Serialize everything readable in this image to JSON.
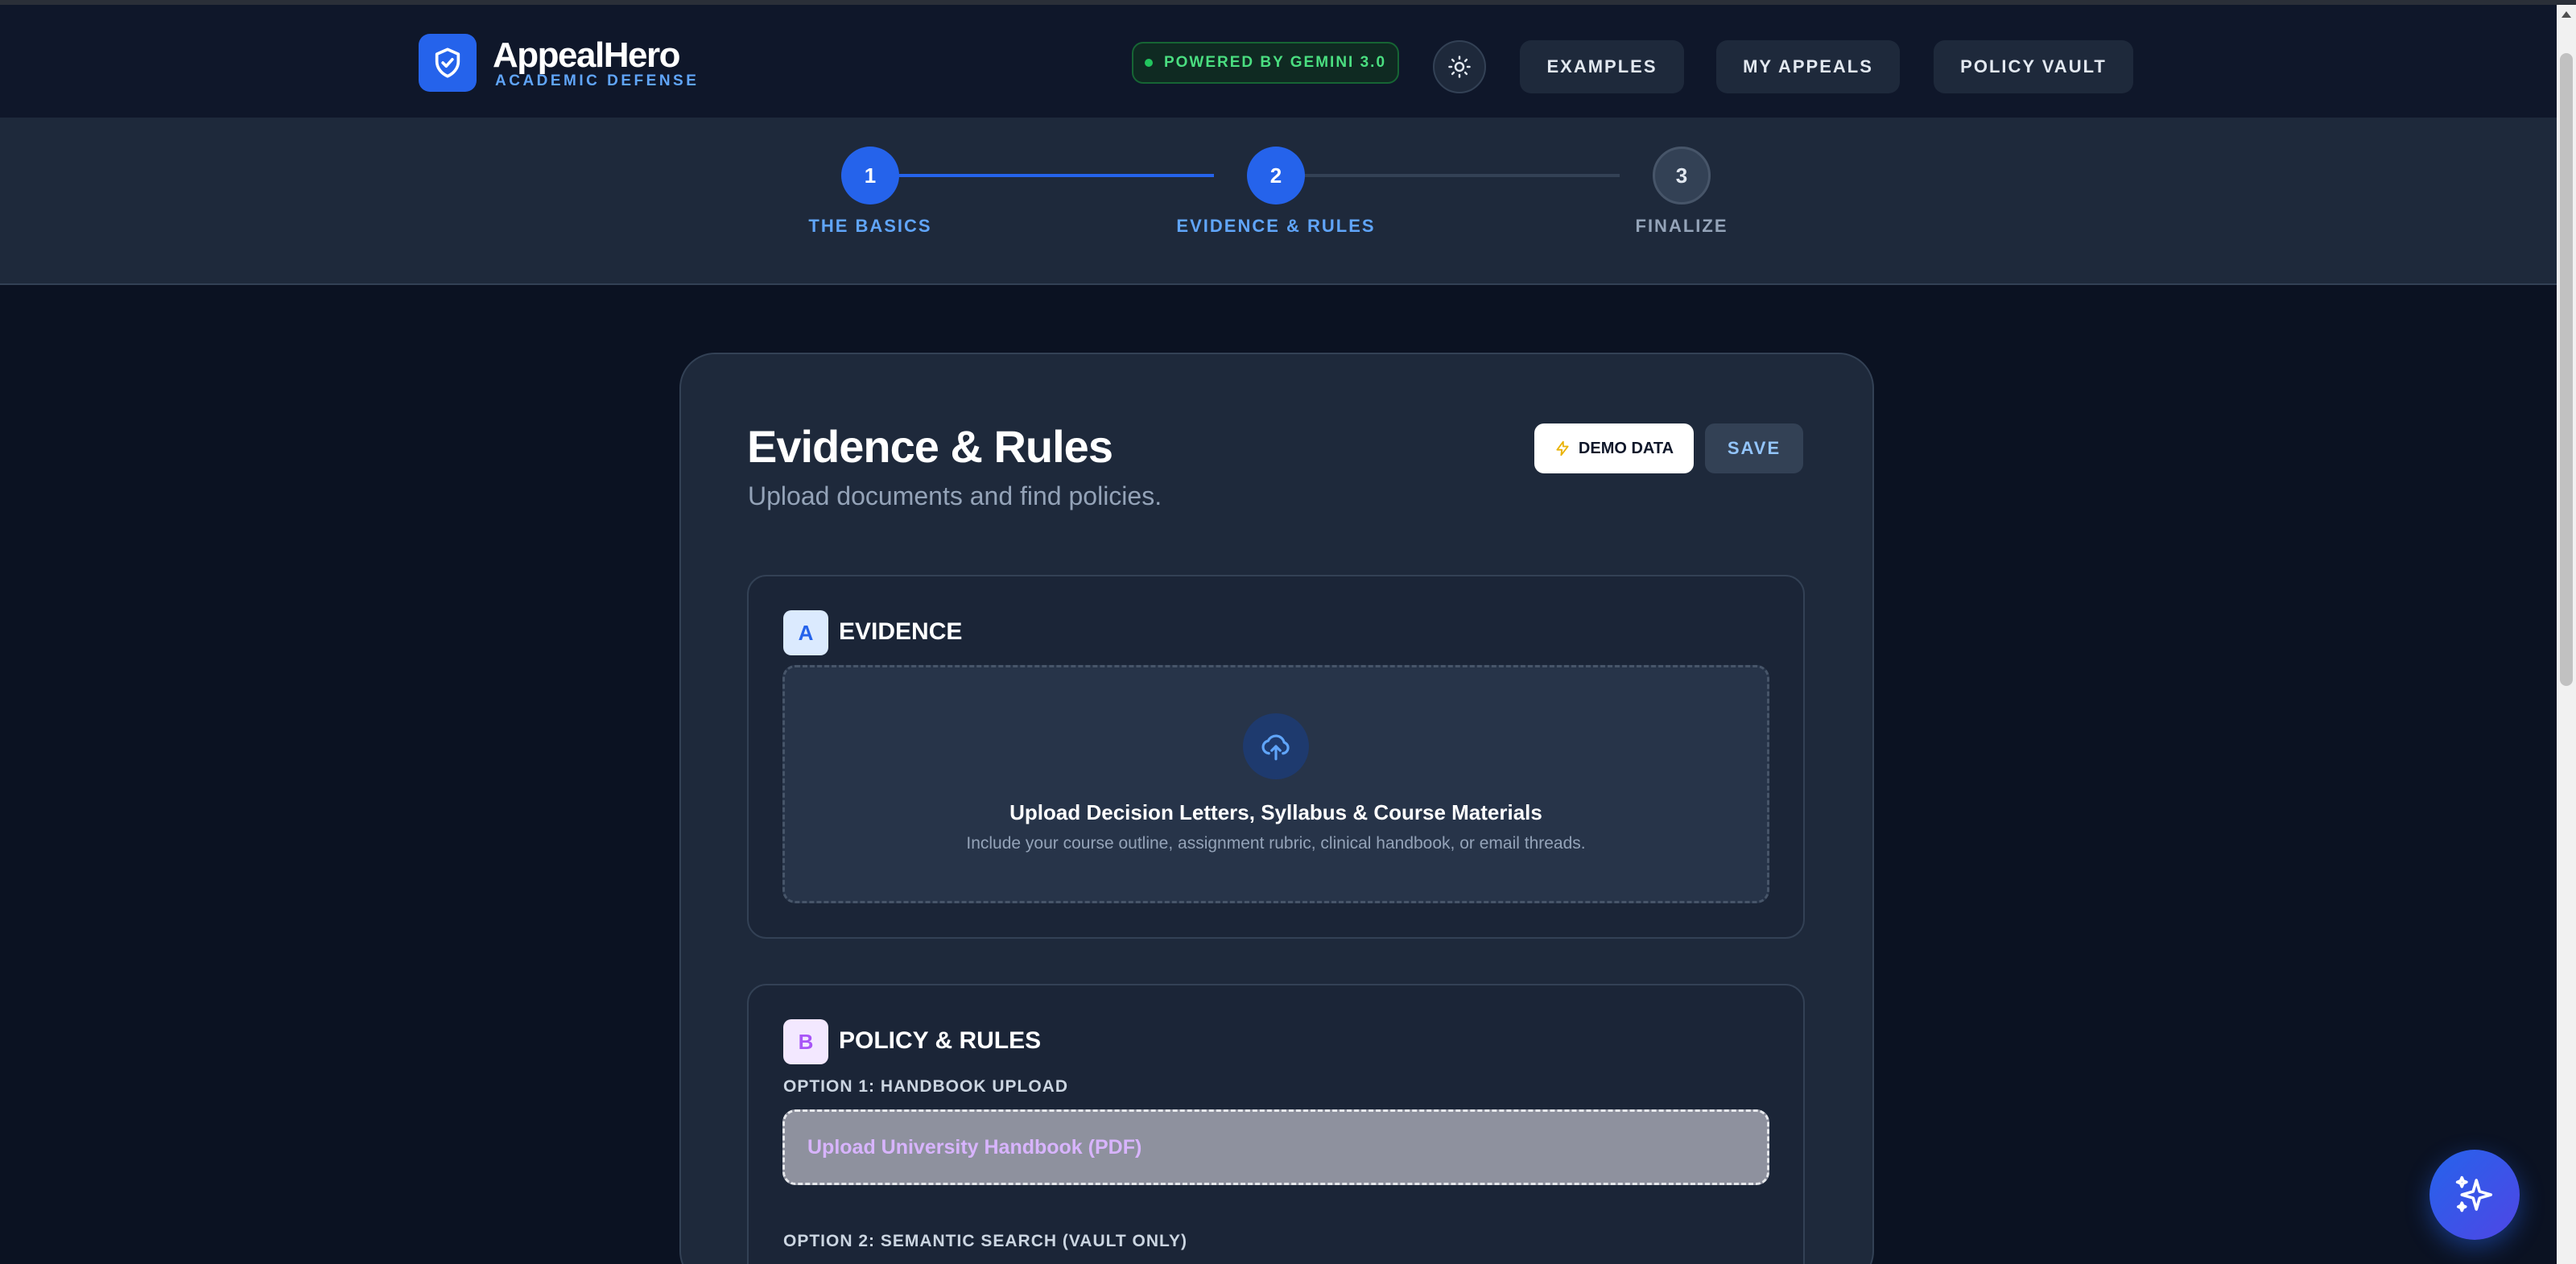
{
  "header": {
    "brand_name": "AppealHero",
    "brand_sub": "ACADEMIC DEFENSE",
    "powered_by": "POWERED BY GEMINI 3.0",
    "nav": {
      "examples": "EXAMPLES",
      "my_appeals": "MY APPEALS",
      "policy_vault": "POLICY VAULT"
    }
  },
  "stepper": {
    "steps": [
      {
        "number": "1",
        "label": "THE BASICS",
        "status": "complete"
      },
      {
        "number": "2",
        "label": "EVIDENCE & RULES",
        "status": "current"
      },
      {
        "number": "3",
        "label": "FINALIZE",
        "status": "upcoming"
      }
    ]
  },
  "main": {
    "title": "Evidence & Rules",
    "subtitle": "Upload documents and find policies.",
    "demo_button": "DEMO DATA",
    "save_button": "SAVE"
  },
  "evidence": {
    "letter": "A",
    "title": "EVIDENCE",
    "upload_title": "Upload Decision Letters, Syllabus & Course Materials",
    "upload_sub": "Include your course outline, assignment rubric, clinical handbook, or email threads."
  },
  "policy": {
    "letter": "B",
    "title": "POLICY & RULES",
    "option1_label": "OPTION 1: HANDBOOK UPLOAD",
    "handbook_button": "Upload University Handbook (PDF)",
    "option2_label": "OPTION 2: SEMANTIC SEARCH (VAULT ONLY)"
  },
  "colors": {
    "background": "#0b1222",
    "accent": "#2563eb",
    "success": "#22c55e",
    "purple": "#a855f7"
  },
  "icons": {
    "logo": "shield-check-icon",
    "theme": "sun-icon",
    "demo": "lightning-icon",
    "upload": "cloud-upload-icon",
    "fab": "sparkles-icon"
  }
}
